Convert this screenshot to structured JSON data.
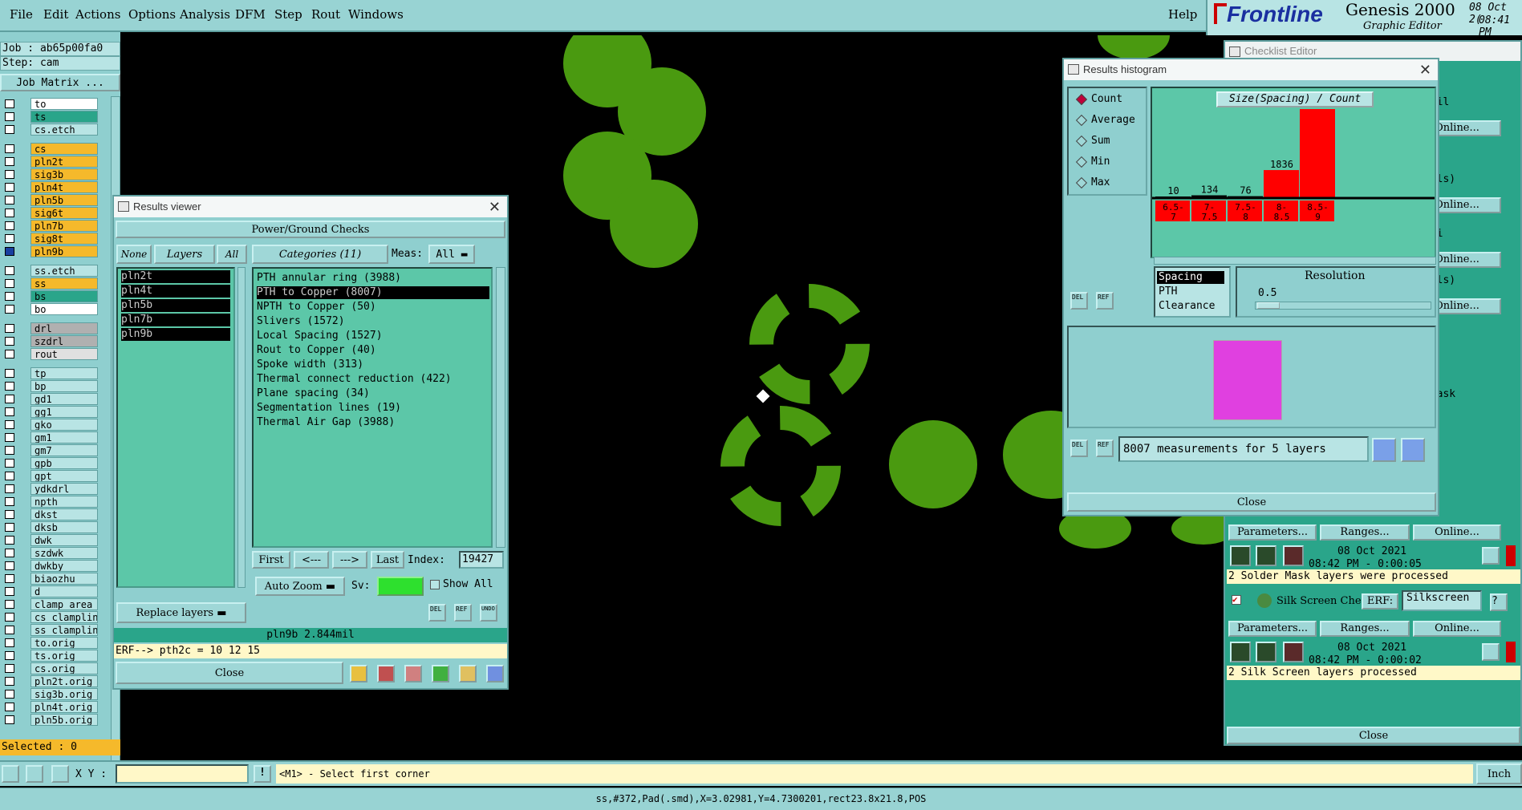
{
  "menu": {
    "items": [
      "File",
      "Edit",
      "Actions",
      "Options",
      "Analysis",
      "DFM",
      "Step",
      "Rout",
      "Windows"
    ],
    "help": "Help"
  },
  "logo": {
    "brand": "Frontline",
    "product": "Genesis 2000",
    "subtitle": "Graphic Editor",
    "date": "08 Oct 2(",
    "time": "08:41 PM"
  },
  "job": {
    "job_line": "Job : ab65p00fa0",
    "step_line": "Step: cam",
    "matrix_button": "Job Matrix ..."
  },
  "layers": [
    {
      "name": "to",
      "color": "#ffffff"
    },
    {
      "name": "ts",
      "color": "#2aa58a"
    },
    {
      "name": "cs.etch",
      "color": "#b8e4e4"
    },
    {
      "name": "cs",
      "color": "#f5b92b"
    },
    {
      "name": "pln2t",
      "color": "#f5b92b"
    },
    {
      "name": "sig3b",
      "color": "#f5b92b"
    },
    {
      "name": "pln4t",
      "color": "#f5b92b"
    },
    {
      "name": "pln5b",
      "color": "#f5b92b"
    },
    {
      "name": "sig6t",
      "color": "#f5b92b"
    },
    {
      "name": "pln7b",
      "color": "#f5b92b"
    },
    {
      "name": "sig8t",
      "color": "#f5b92b"
    },
    {
      "name": "pln9b",
      "color": "#f5b92b"
    },
    {
      "name": "ss.etch",
      "color": "#b8e4e4"
    },
    {
      "name": "ss",
      "color": "#f5b92b"
    },
    {
      "name": "bs",
      "color": "#2aa58a"
    },
    {
      "name": "bo",
      "color": "#ffffff"
    },
    {
      "name": "drl",
      "color": "#b0b0b0"
    },
    {
      "name": "szdrl",
      "color": "#b0b0b0"
    },
    {
      "name": "rout",
      "color": "#e0e0e0"
    },
    {
      "name": "tp",
      "color": "#b8e4e4"
    },
    {
      "name": "bp",
      "color": "#b8e4e4"
    },
    {
      "name": "gd1",
      "color": "#b8e4e4"
    },
    {
      "name": "gg1",
      "color": "#b8e4e4"
    },
    {
      "name": "gko",
      "color": "#b8e4e4"
    },
    {
      "name": "gm1",
      "color": "#b8e4e4"
    },
    {
      "name": "gm7",
      "color": "#b8e4e4"
    },
    {
      "name": "gpb",
      "color": "#b8e4e4"
    },
    {
      "name": "gpt",
      "color": "#b8e4e4"
    },
    {
      "name": "ydkdrl",
      "color": "#b8e4e4"
    },
    {
      "name": "npth",
      "color": "#b8e4e4"
    },
    {
      "name": "dkst",
      "color": "#b8e4e4"
    },
    {
      "name": "dksb",
      "color": "#b8e4e4"
    },
    {
      "name": "dwk",
      "color": "#b8e4e4"
    },
    {
      "name": "szdwk",
      "color": "#b8e4e4"
    },
    {
      "name": "dwkby",
      "color": "#b8e4e4"
    },
    {
      "name": "biaozhu",
      "color": "#b8e4e4"
    },
    {
      "name": "d",
      "color": "#b8e4e4"
    },
    {
      "name": "clamp_area",
      "color": "#b8e4e4"
    },
    {
      "name": "cs_clampline",
      "color": "#b8e4e4"
    },
    {
      "name": "ss_clampline",
      "color": "#b8e4e4"
    },
    {
      "name": "to.orig",
      "color": "#b8e4e4"
    },
    {
      "name": "ts.orig",
      "color": "#b8e4e4"
    },
    {
      "name": "cs.orig",
      "color": "#b8e4e4"
    },
    {
      "name": "pln2t.orig",
      "color": "#b8e4e4"
    },
    {
      "name": "sig3b.orig",
      "color": "#b8e4e4"
    },
    {
      "name": "pln4t.orig",
      "color": "#b8e4e4"
    },
    {
      "name": "pln5b.orig",
      "color": "#b8e4e4"
    }
  ],
  "selected": "Selected : 0",
  "results_viewer": {
    "title": "Results viewer",
    "header": "Power/Ground Checks",
    "none": "None",
    "layers_label": "Layers",
    "all": "All",
    "layer_list": [
      "pln2t",
      "pln4t",
      "pln5b",
      "pln7b",
      "pln9b"
    ],
    "categories_label": "Categories (11)",
    "meas_label": "Meas:",
    "meas_value": "All",
    "categories": [
      "PTH annular ring (3988)",
      "PTH to Copper (8007)",
      "NPTH to Copper (50)",
      "Slivers (1572)",
      "Local Spacing (1527)",
      "Rout to Copper (40)",
      "Spoke width (313)",
      "Thermal connect reduction (422)",
      "Plane spacing (34)",
      "Segmentation lines (19)",
      "Thermal Air Gap (3988)"
    ],
    "nav": {
      "first": "First",
      "prev": "<---",
      "next": "--->",
      "last": "Last",
      "index_label": "Index:",
      "index_value": "19427"
    },
    "auto_zoom": "Auto Zoom",
    "sv_label": "Sv:",
    "show_all": "Show All",
    "replace_layers": "Replace layers",
    "del": "DEL",
    "ref": "REF",
    "undo": "UNDO",
    "status1": "pln9b 2.844mil",
    "status2": "ERF--> pth2c = 10 12 15",
    "close": "Close"
  },
  "histogram": {
    "title": "Results histogram",
    "modes": [
      "Count",
      "Average",
      "Sum",
      "Min",
      "Max"
    ],
    "chart_title": "Size(Spacing) / Count",
    "spacing_list": [
      "Spacing",
      "PTH",
      "Clearance"
    ],
    "resolution_label": "Resolution",
    "resolution_value": "0.5",
    "measurements": "8007 measurements for 5 layers",
    "close": "Close",
    "chart_data": {
      "type": "bar",
      "title": "Size(Spacing) / Count",
      "categories": [
        "6.5-7",
        "7-7.5",
        "7.5-8",
        "8-8.5",
        "8.5-9"
      ],
      "values": [
        10,
        134,
        76,
        1836,
        5951
      ],
      "ylim": [
        0,
        5951
      ]
    }
  },
  "checklist": {
    "title": "Checklist Editor",
    "right_labels": [
      "(Mil",
      "Online...",
      "mils)",
      "Online...",
      "(Mi",
      "Online...",
      "mils)",
      "Online...",
      "ed",
      "rmask"
    ],
    "params": "Parameters...",
    "ranges": "Ranges...",
    "online": "Online...",
    "date": "08 Oct 2021",
    "run1": "08:42 PM - 0:00:05",
    "msg1": "2 Solder Mask layers were processed",
    "silk_name": "Silk Screen Che",
    "erf": "ERF:",
    "erf_value": "Silkscreen",
    "run2": "08:42 PM - 0:00:02",
    "msg2": "2 Silk Screen layers processed",
    "close": "Close"
  },
  "status": {
    "xy_label": "X Y :",
    "message": "<M1> - Select first corner",
    "units": "Inch"
  },
  "bottom": "ss,#372,Pad(.smd),X=3.02981,Y=4.7300201,rect23.8x21.8,POS"
}
